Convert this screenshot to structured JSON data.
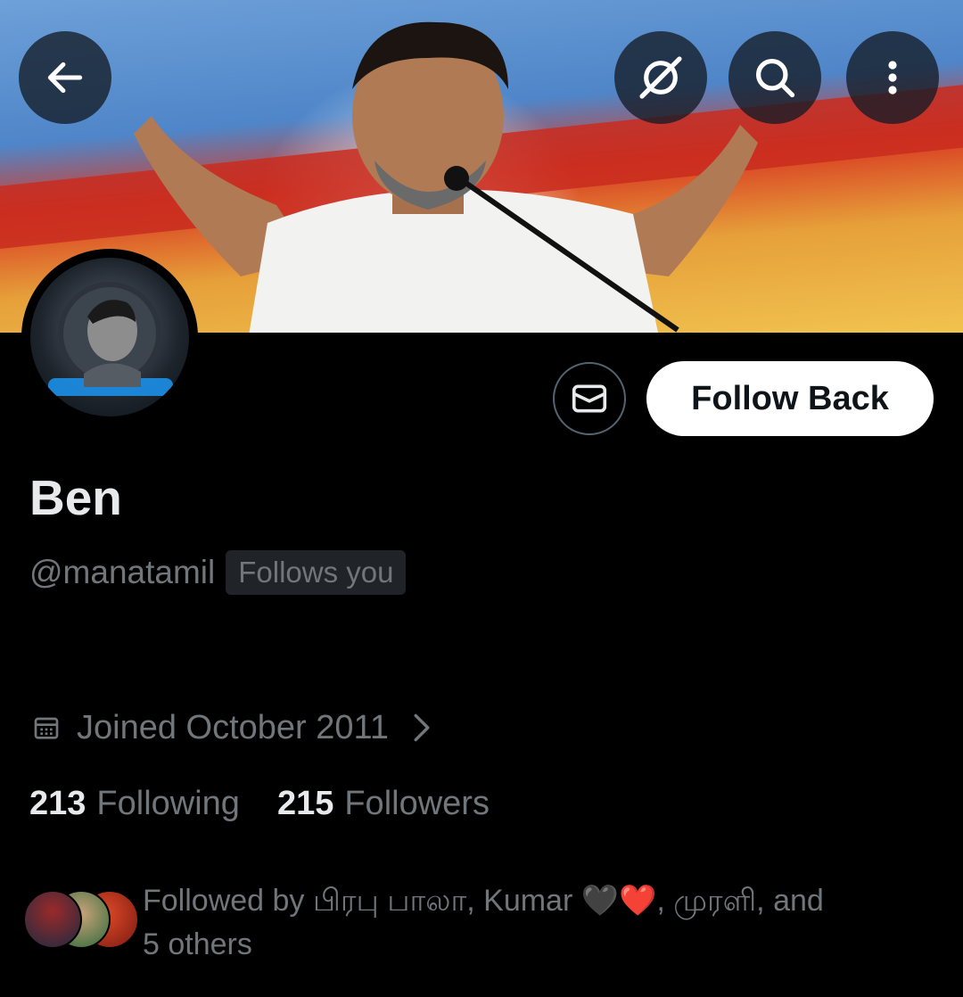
{
  "header": {
    "back_icon": "arrow-left-icon",
    "grok_icon": "grok-icon",
    "search_icon": "search-icon",
    "more_icon": "more-vertical-icon"
  },
  "profile": {
    "name": "Ben",
    "handle": "@manatamil",
    "follows_you_badge": "Follows you",
    "joined": "Joined October 2011",
    "following_count": "213",
    "following_label": "Following",
    "followers_count": "215",
    "followers_label": "Followers",
    "followed_by_line1": "Followed by பிரபு பாலா, Kumar 🖤❤️, முரளி, and",
    "followed_by_line2": "5 others"
  },
  "actions": {
    "message_icon": "envelope-icon",
    "follow_back_label": "Follow Back"
  },
  "colors": {
    "background": "#000000",
    "primary_text": "#e7e9ea",
    "secondary_text": "#71767b",
    "button_bg": "#ffffff",
    "badge_bg": "#202327"
  }
}
